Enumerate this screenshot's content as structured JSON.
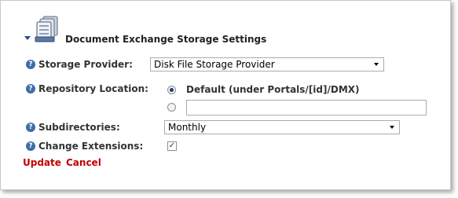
{
  "header": {
    "title": "Document Exchange Storage Settings",
    "icon": "storage-module-icon",
    "collapse_icon": "collapse-arrow-icon"
  },
  "fields": {
    "storage_provider": {
      "label": "Storage Provider:",
      "selected": "Disk File Storage Provider"
    },
    "repository_location": {
      "label": "Repository Location:",
      "default_option": "Default (under Portals/[id]/DMX)",
      "default_selected": true,
      "custom_path_value": ""
    },
    "subdirectories": {
      "label": "Subdirectories:",
      "selected": "Monthly"
    },
    "change_extensions": {
      "label": "Change Extensions:",
      "checked": true
    }
  },
  "actions": {
    "update_label": "Update",
    "cancel_label": "Cancel"
  },
  "colors": {
    "action_text": "#c00000",
    "help_icon": "#3d6ea8",
    "panel_border": "#c8c8c8"
  }
}
